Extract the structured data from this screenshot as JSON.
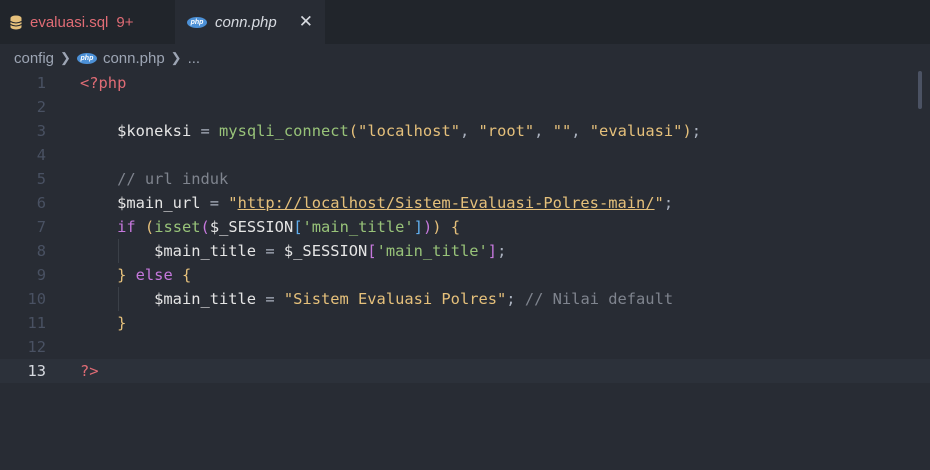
{
  "tabs": [
    {
      "name": "evaluasi.sql",
      "badge": "9+",
      "icon": "database-icon"
    },
    {
      "name": "conn.php",
      "icon": "php-icon",
      "close": "✕"
    }
  ],
  "breadcrumb": {
    "folder": "config",
    "file": "conn.php",
    "tail": "..."
  },
  "php_icon_text": "php",
  "colors": {
    "background": "#282c34",
    "tag": "#e06c75",
    "string": "#e5c07b",
    "function": "#98c379",
    "comment": "#7f848e"
  },
  "active_line": 13,
  "lines": [
    {
      "n": "1",
      "t": [
        [
          "<?php",
          "tag"
        ]
      ]
    },
    {
      "n": "2",
      "t": []
    },
    {
      "n": "3",
      "t": [
        [
          "    ",
          "plain"
        ],
        [
          "$koneksi",
          "var"
        ],
        [
          " = ",
          "plain"
        ],
        [
          "mysqli_connect",
          "fn"
        ],
        [
          "(",
          "paren"
        ],
        [
          "\"localhost\"",
          "str"
        ],
        [
          ", ",
          "plain"
        ],
        [
          "\"root\"",
          "str"
        ],
        [
          ", ",
          "plain"
        ],
        [
          "\"\"",
          "str"
        ],
        [
          ", ",
          "plain"
        ],
        [
          "\"evaluasi\"",
          "str"
        ],
        [
          ")",
          "paren"
        ],
        [
          ";",
          "plain"
        ]
      ]
    },
    {
      "n": "4",
      "t": []
    },
    {
      "n": "5",
      "t": [
        [
          "    ",
          "plain"
        ],
        [
          "// url induk",
          "comment"
        ]
      ]
    },
    {
      "n": "6",
      "t": [
        [
          "    ",
          "plain"
        ],
        [
          "$main_url",
          "var"
        ],
        [
          " = ",
          "plain"
        ],
        [
          "\"",
          "str"
        ],
        [
          "http://localhost/Sistem-Evaluasi-Polres-main/",
          "url"
        ],
        [
          "\"",
          "str"
        ],
        [
          ";",
          "plain"
        ]
      ]
    },
    {
      "n": "7",
      "t": [
        [
          "    ",
          "plain"
        ],
        [
          "if",
          "kw"
        ],
        [
          " ",
          "plain"
        ],
        [
          "(",
          "paren"
        ],
        [
          "isset",
          "fn"
        ],
        [
          "(",
          "paren2"
        ],
        [
          "$_SESSION",
          "var"
        ],
        [
          "[",
          "brk"
        ],
        [
          "'main_title'",
          "str2"
        ],
        [
          "]",
          "brk"
        ],
        [
          ")",
          "paren2"
        ],
        [
          ")",
          "paren"
        ],
        [
          " ",
          "plain"
        ],
        [
          "{",
          "paren"
        ]
      ]
    },
    {
      "n": "8",
      "t": [
        [
          "        ",
          "plain"
        ],
        [
          "$main_title",
          "var"
        ],
        [
          " = ",
          "plain"
        ],
        [
          "$_SESSION",
          "var"
        ],
        [
          "[",
          "paren2"
        ],
        [
          "'main_title'",
          "str2"
        ],
        [
          "]",
          "paren2"
        ],
        [
          ";",
          "plain"
        ]
      ]
    },
    {
      "n": "9",
      "t": [
        [
          "    ",
          "plain"
        ],
        [
          "}",
          "paren"
        ],
        [
          " ",
          "plain"
        ],
        [
          "else",
          "kw"
        ],
        [
          " ",
          "plain"
        ],
        [
          "{",
          "paren"
        ]
      ]
    },
    {
      "n": "10",
      "t": [
        [
          "        ",
          "plain"
        ],
        [
          "$main_title",
          "var"
        ],
        [
          " = ",
          "plain"
        ],
        [
          "\"Sistem Evaluasi Polres\"",
          "str"
        ],
        [
          ";",
          "plain"
        ],
        [
          " ",
          "plain"
        ],
        [
          "// Nilai default",
          "comment"
        ]
      ]
    },
    {
      "n": "11",
      "t": [
        [
          "    ",
          "plain"
        ],
        [
          "}",
          "paren"
        ]
      ]
    },
    {
      "n": "12",
      "t": []
    },
    {
      "n": "13",
      "t": [
        [
          "?>",
          "tag"
        ]
      ]
    }
  ]
}
